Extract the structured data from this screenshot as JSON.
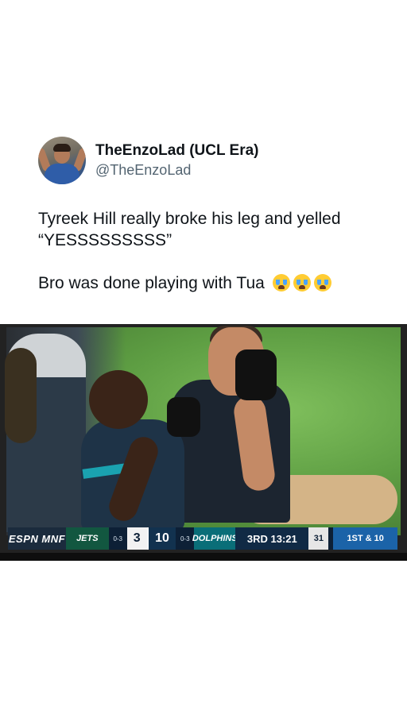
{
  "tweet": {
    "author": {
      "display_name": "TheEnzoLad (UCL Era)",
      "handle": "@TheEnzoLad"
    },
    "text_line_1": "Tyreek Hill really broke his leg and yelled “YESSSSSSSSS”",
    "text_line_2": "Bro was done playing with Tua",
    "emojis": [
      "loudly-crying-face",
      "loudly-crying-face",
      "loudly-crying-face"
    ]
  },
  "media": {
    "scorebug": {
      "network": "ESPN MNF",
      "away_team": "JETS",
      "away_record": "0-3",
      "away_score": "3",
      "home_score": "10",
      "home_record": "0-3",
      "home_team": "DOLPHINS",
      "clock": "3RD 13:21",
      "play_clock": "31",
      "down_distance": "1ST & 10"
    }
  },
  "colors": {
    "text_primary": "#0f1419",
    "text_secondary": "#536471",
    "scorebug_bg": "#0d2036",
    "jets_green": "#125740",
    "dolphins_aqua": "#0a6e78"
  }
}
